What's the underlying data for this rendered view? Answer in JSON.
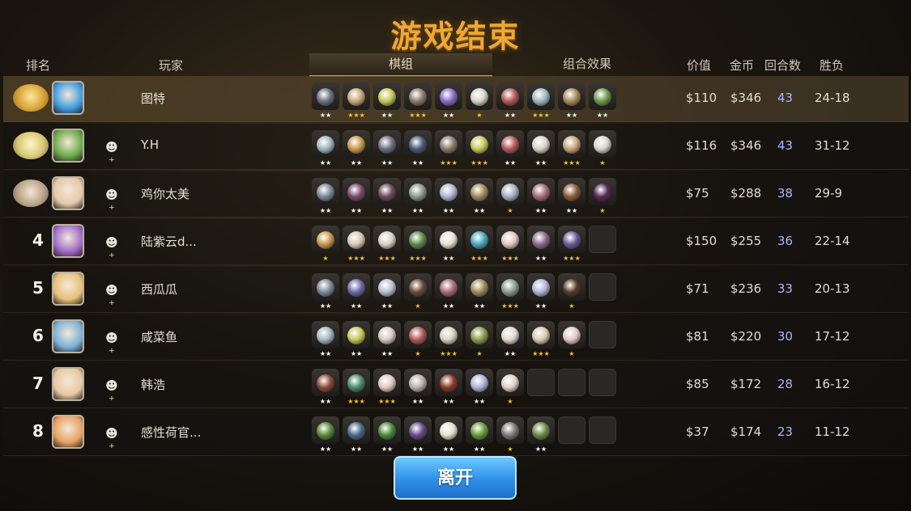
{
  "title": "游戏结束",
  "headers": {
    "rank": "排名",
    "player": "玩家",
    "lineup_tab": "棋组",
    "synergy_tab": "组合效果",
    "value": "价值",
    "gold": "金币",
    "rounds": "回合数",
    "wl": "胜负"
  },
  "leave_button": "离开",
  "add_friend_icon": "add-friend-icon",
  "colors": {
    "title": "#f0a832",
    "star_gold": "#f2c530",
    "star_white": "#ffffff",
    "rounds_text": "#a9b6ff",
    "leave_button": "#2f8fe8"
  },
  "players": [
    {
      "rank": "",
      "medal": "gold",
      "avatar": "#3f9be0",
      "name": "图特",
      "value": "$110",
      "gold": "$346",
      "rounds": "43",
      "wl": "24-18",
      "add_friend": false,
      "pieces": [
        {
          "c": "#6b7280",
          "s": "★★"
        },
        {
          "c": "#c9a67a",
          "s": "★★★"
        },
        {
          "c": "#c4c85a",
          "s": "★★"
        },
        {
          "c": "#8a7a6a",
          "s": "★★★"
        },
        {
          "c": "#8a6bc9",
          "s": "★★"
        },
        {
          "c": "#d9d4c8",
          "s": "★"
        },
        {
          "c": "#b4585a",
          "s": "★★"
        },
        {
          "c": "#9fb8c0",
          "s": "★★★"
        },
        {
          "c": "#a88a5a",
          "s": "★★"
        },
        {
          "c": "#6a9a4a",
          "s": "★★"
        }
      ]
    },
    {
      "rank": "",
      "medal": "silver",
      "avatar": "#6aa84a",
      "name": "Y.H",
      "value": "$116",
      "gold": "$346",
      "rounds": "43",
      "wl": "31-12",
      "add_friend": true,
      "pieces": [
        {
          "c": "#9fb8c0",
          "s": "★★"
        },
        {
          "c": "#c99a4a",
          "s": "★★"
        },
        {
          "c": "#6b7280",
          "s": "★★"
        },
        {
          "c": "#4a5a7a",
          "s": "★★"
        },
        {
          "c": "#8a7a6a",
          "s": "★★★"
        },
        {
          "c": "#c4c85a",
          "s": "★★★"
        },
        {
          "c": "#b4585a",
          "s": "★★"
        },
        {
          "c": "#d9d4c8",
          "s": "★★"
        },
        {
          "c": "#c9a67a",
          "s": "★★★"
        },
        {
          "c": "#d9d4c8",
          "s": "★"
        }
      ]
    },
    {
      "rank": "",
      "medal": "bronze",
      "avatar": "#e6c8a8",
      "name": "鸡你太美",
      "value": "$75",
      "gold": "$288",
      "rounds": "38",
      "wl": "29-9",
      "add_friend": true,
      "pieces": [
        {
          "c": "#7a8a9a",
          "s": "★★"
        },
        {
          "c": "#7a4a6a",
          "s": "★★"
        },
        {
          "c": "#6a4a5a",
          "s": "★★"
        },
        {
          "c": "#8a9a8a",
          "s": "★★"
        },
        {
          "c": "#b0b4d8",
          "s": "★★"
        },
        {
          "c": "#a08a5a",
          "s": "★★"
        },
        {
          "c": "#a8b0c0",
          "s": "★"
        },
        {
          "c": "#a86a7a",
          "s": "★★"
        },
        {
          "c": "#8a5a3a",
          "s": "★★"
        },
        {
          "c": "#5a2a5a",
          "s": "★"
        }
      ]
    },
    {
      "rank": "4",
      "medal": "",
      "avatar": "#a06ac8",
      "name": "陆紫云d...",
      "value": "$150",
      "gold": "$255",
      "rounds": "36",
      "wl": "22-14",
      "add_friend": true,
      "pieces": [
        {
          "c": "#c99a4a",
          "s": "★"
        },
        {
          "c": "#d8c8b0",
          "s": "★★★"
        },
        {
          "c": "#d8d0c0",
          "s": "★★★"
        },
        {
          "c": "#5a8a4a",
          "s": "★★★"
        },
        {
          "c": "#e8e0d0",
          "s": "★★"
        },
        {
          "c": "#4aa8b8",
          "s": "★★★"
        },
        {
          "c": "#e0c8c0",
          "s": "★★★"
        },
        {
          "c": "#8a6a8a",
          "s": "★★"
        },
        {
          "c": "#6a5a9a",
          "s": "★★★"
        },
        {
          "c": "",
          "s": ""
        }
      ]
    },
    {
      "rank": "5",
      "medal": "",
      "avatar": "#e8c078",
      "name": "西瓜瓜",
      "value": "$71",
      "gold": "$236",
      "rounds": "33",
      "wl": "20-13",
      "add_friend": true,
      "pieces": [
        {
          "c": "#7a8a9a",
          "s": "★★"
        },
        {
          "c": "#6a6aa8",
          "s": "★★"
        },
        {
          "c": "#b8c0d0",
          "s": "★★"
        },
        {
          "c": "#6a4a3a",
          "s": "★"
        },
        {
          "c": "#a86a7a",
          "s": "★★"
        },
        {
          "c": "#a08a5a",
          "s": "★★"
        },
        {
          "c": "#8a9a8a",
          "s": "★★★"
        },
        {
          "c": "#b0b4d8",
          "s": "★★"
        },
        {
          "c": "#5a3a2a",
          "s": "★"
        },
        {
          "c": "",
          "s": ""
        }
      ]
    },
    {
      "rank": "6",
      "medal": "",
      "avatar": "#7ab0d8",
      "name": "咸菜鱼",
      "value": "$81",
      "gold": "$220",
      "rounds": "30",
      "wl": "17-12",
      "add_friend": true,
      "pieces": [
        {
          "c": "#9fb8c0",
          "s": "★★"
        },
        {
          "c": "#c4c85a",
          "s": "★★"
        },
        {
          "c": "#d8c8c0",
          "s": "★★"
        },
        {
          "c": "#b4585a",
          "s": "★"
        },
        {
          "c": "#d8d0c0",
          "s": "★★★"
        },
        {
          "c": "#8a9a4a",
          "s": "★"
        },
        {
          "c": "#e0d8c8",
          "s": "★★"
        },
        {
          "c": "#d8c8b0",
          "s": "★★★"
        },
        {
          "c": "#e0c8c0",
          "s": "★"
        },
        {
          "c": "",
          "s": ""
        }
      ]
    },
    {
      "rank": "7",
      "medal": "",
      "avatar": "#e8c8a0",
      "name": "韩浩",
      "value": "$85",
      "gold": "$172",
      "rounds": "28",
      "wl": "16-12",
      "add_friend": true,
      "pieces": [
        {
          "c": "#8a4a3a",
          "s": "★★"
        },
        {
          "c": "#4a8a6a",
          "s": "★★★"
        },
        {
          "c": "#e0c8c0",
          "s": "★★★"
        },
        {
          "c": "#b8b0a8",
          "s": "★★"
        },
        {
          "c": "#8a3a2a",
          "s": "★★"
        },
        {
          "c": "#b0b4d8",
          "s": "★★"
        },
        {
          "c": "#e0d0c8",
          "s": "★"
        },
        {
          "c": "",
          "s": ""
        },
        {
          "c": "",
          "s": ""
        },
        {
          "c": "",
          "s": ""
        }
      ]
    },
    {
      "rank": "8",
      "medal": "",
      "avatar": "#e8a060",
      "name": "感性荷官...",
      "value": "$37",
      "gold": "$174",
      "rounds": "23",
      "wl": "11-12",
      "add_friend": true,
      "pieces": [
        {
          "c": "#5a8a3a",
          "s": "★★"
        },
        {
          "c": "#4a6a8a",
          "s": "★★"
        },
        {
          "c": "#4a8a3a",
          "s": "★★"
        },
        {
          "c": "#6a4a8a",
          "s": "★★"
        },
        {
          "c": "#e8e0d0",
          "s": "★★"
        },
        {
          "c": "#6a9a3a",
          "s": "★★"
        },
        {
          "c": "#7a7a7a",
          "s": "★"
        },
        {
          "c": "#6a8a4a",
          "s": "★★"
        },
        {
          "c": "",
          "s": ""
        },
        {
          "c": "",
          "s": ""
        }
      ]
    }
  ]
}
